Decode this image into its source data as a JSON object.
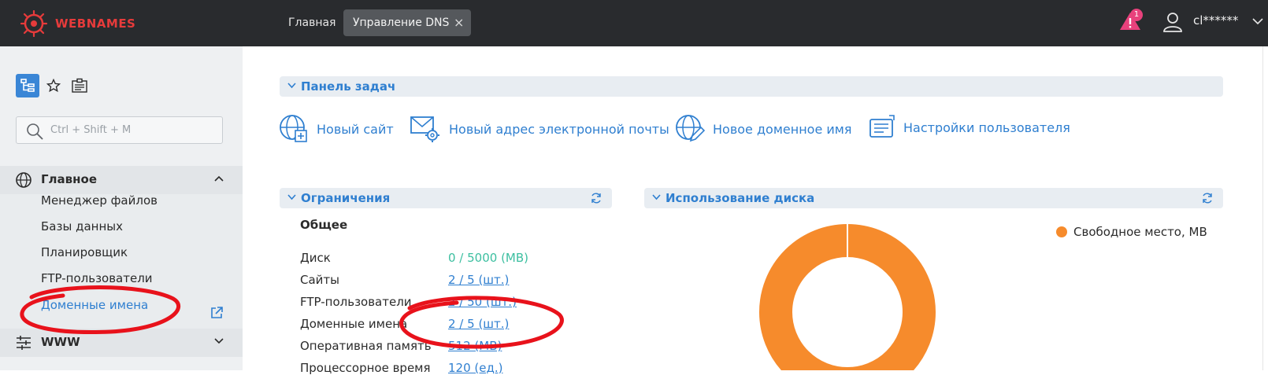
{
  "header": {
    "logo_text": "WEBNAMES",
    "tabs": [
      {
        "label": "Главная"
      },
      {
        "label": "Управление DNS",
        "close": "×"
      }
    ],
    "alert_count": "1",
    "user_name": "cl******"
  },
  "sidebar": {
    "search_placeholder": "Ctrl + Shift + M",
    "sections": [
      {
        "label": "Главное",
        "expanded": true
      },
      {
        "label": "WWW",
        "expanded": false
      }
    ],
    "items": [
      {
        "label": "Менеджер файлов"
      },
      {
        "label": "Базы данных"
      },
      {
        "label": "Планировщик"
      },
      {
        "label": "FTP-пользователи"
      },
      {
        "label": "Доменные имена",
        "active": true
      }
    ]
  },
  "taskbar": {
    "title": "Панель задач",
    "tasks": [
      {
        "label": "Новый сайт",
        "icon": "globe-plus-icon"
      },
      {
        "label": "Новый адрес электронной почты",
        "icon": "mail-gear-icon"
      },
      {
        "label": "Новое доменное имя",
        "icon": "globe-edit-icon"
      },
      {
        "label": "Настройки пользователя",
        "icon": "user-settings-icon"
      }
    ]
  },
  "limits": {
    "title": "Ограничения",
    "subtitle": "Общее",
    "rows": [
      {
        "label": "Диск",
        "value": "0 / 5000 (MB)"
      },
      {
        "label": "Сайты",
        "value": "2 / 5 (шт.)"
      },
      {
        "label": "FTP-пользователи",
        "value": "2 / 50 (шт.)"
      },
      {
        "label": "Доменные имена",
        "value": "2 / 5 (шт.)"
      },
      {
        "label": "Оперативная память",
        "value": "512 (MB)"
      },
      {
        "label": "Процессорное время",
        "value": "120 (ед.)"
      }
    ]
  },
  "disk_usage": {
    "title": "Использование диска",
    "legend": "Свободное место, MB"
  },
  "chart_data": {
    "type": "pie",
    "title": "",
    "series": [
      {
        "name": "Свободное место, MB",
        "values": [
          5000
        ]
      }
    ],
    "categories": [
      "Свободное место, MB"
    ],
    "legend_position": "top-right"
  },
  "colors": {
    "accent": "#2f7fd0",
    "brand": "#e63b3b",
    "donut": "#f68b2c",
    "annotation": "#e8121b"
  }
}
